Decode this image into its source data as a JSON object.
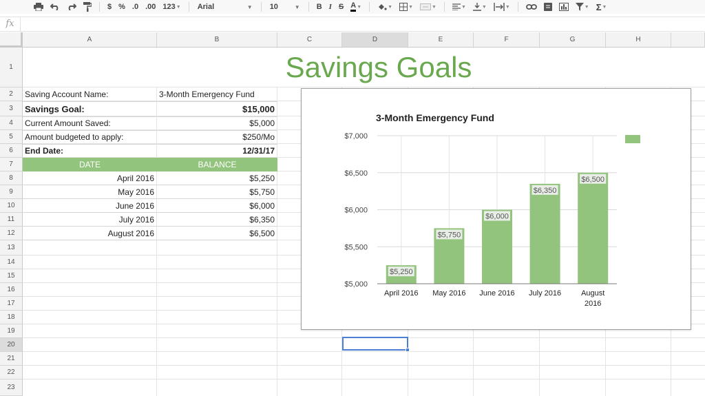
{
  "toolbar": {
    "currency_label": "$",
    "percent_label": "%",
    "decrease_decimals_label": ".0",
    "increase_decimals_label": ".00",
    "more_formats_label": "123",
    "font_family": "Arial",
    "font_size": "10",
    "bold_label": "B",
    "italic_label": "I",
    "strike_label": "S",
    "text_color_label": "A",
    "function_label": "Σ"
  },
  "formula_bar": {
    "fx_label": "fx",
    "value": ""
  },
  "columns": [
    "A",
    "B",
    "C",
    "D",
    "E",
    "F",
    "G",
    "H"
  ],
  "rows": [
    "1",
    "2",
    "3",
    "4",
    "5",
    "6",
    "7",
    "8",
    "9",
    "10",
    "11",
    "12",
    "13",
    "14",
    "15",
    "16",
    "17",
    "18",
    "19",
    "20",
    "21",
    "22",
    "23"
  ],
  "sheet": {
    "title": "Savings Goals",
    "account_name_label": "Saving Account Name:",
    "account_name_value": "3-Month Emergency Fund",
    "goal_label": "Savings Goal:",
    "goal_value": "$15,000",
    "current_label": "Current Amount Saved:",
    "current_value": "$5,000",
    "budget_label": "Amount budgeted to apply:",
    "budget_value": "$250/Mo",
    "end_date_label": "End Date:",
    "end_date_value": "12/31/17",
    "table_headers": [
      "DATE",
      "BALANCE"
    ],
    "table_rows": [
      {
        "date": "April 2016",
        "balance": "$5,250"
      },
      {
        "date": "May 2016",
        "balance": "$5,750"
      },
      {
        "date": "June 2016",
        "balance": "$6,000"
      },
      {
        "date": "July 2016",
        "balance": "$6,350"
      },
      {
        "date": "August 2016",
        "balance": "$6,500"
      }
    ]
  },
  "colors": {
    "accent_green": "#6aa84f",
    "bar_green": "#93c47d",
    "selection_blue": "#4a7fd8"
  },
  "chart_data": {
    "type": "bar",
    "title": "3-Month Emergency Fund",
    "categories": [
      "April 2016",
      "May 2016",
      "June 2016",
      "July 2016",
      "August 2016"
    ],
    "category_lines": [
      [
        "April 2016"
      ],
      [
        "May 2016"
      ],
      [
        "June 2016"
      ],
      [
        "July 2016"
      ],
      [
        "August",
        "2016"
      ]
    ],
    "values": [
      5250,
      5750,
      6000,
      6350,
      6500
    ],
    "data_labels": [
      "$5,250",
      "$5,750",
      "$6,000",
      "$6,350",
      "$6,500"
    ],
    "ylim": [
      5000,
      7000
    ],
    "yticks": [
      5000,
      5500,
      6000,
      6500,
      7000
    ],
    "ytick_labels": [
      "$5,000",
      "$5,500",
      "$6,000",
      "$6,500",
      "$7,000"
    ],
    "grid": true,
    "legend": "right",
    "bar_color": "#93c47d"
  }
}
